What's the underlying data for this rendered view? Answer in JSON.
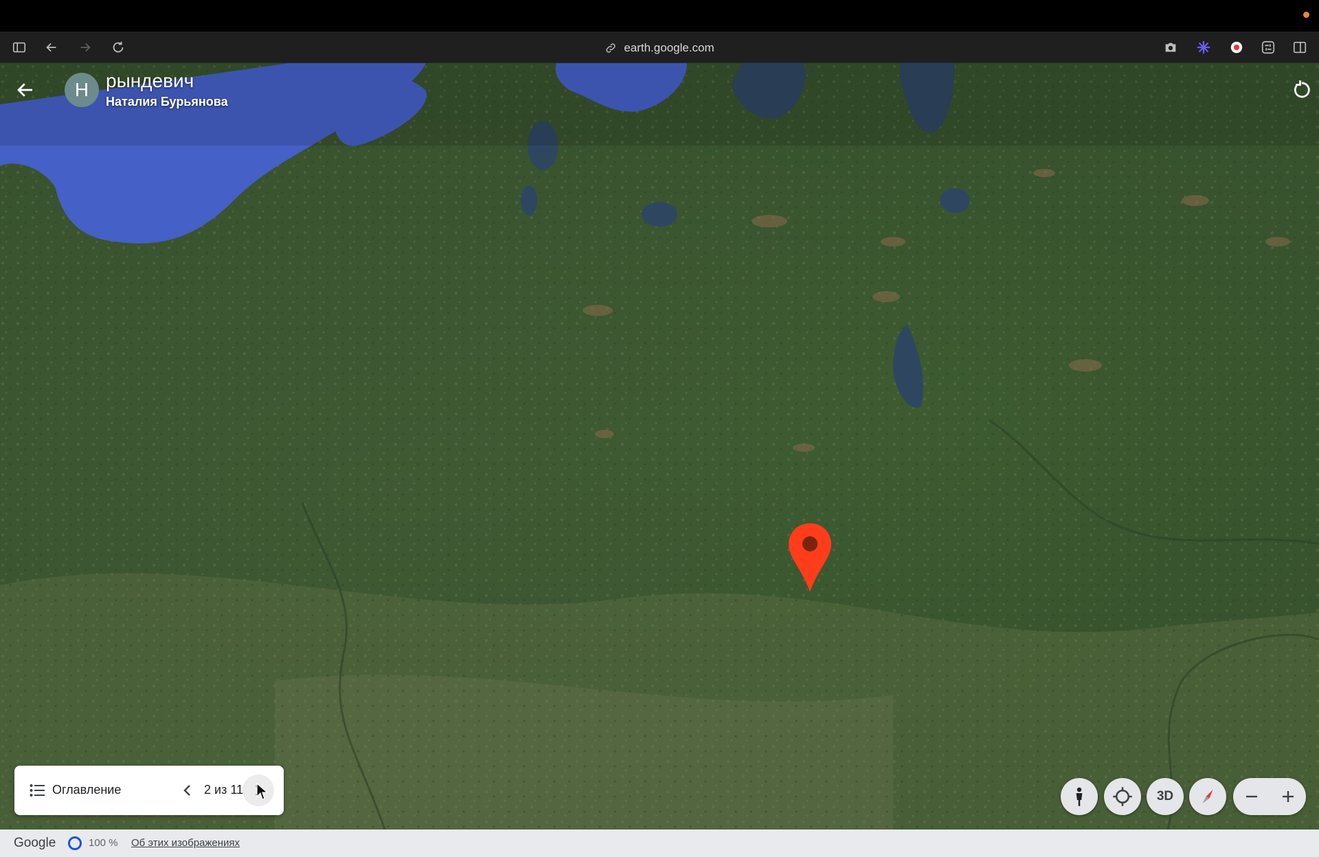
{
  "browser": {
    "url": "earth.google.com"
  },
  "tour": {
    "avatar_letter": "Н",
    "title": "рындевич",
    "author": "Наталия Бурьянова"
  },
  "navigator": {
    "toc_label": "Оглавление",
    "counter": "2 из 11"
  },
  "map_controls": {
    "three_d_label": "3D"
  },
  "statusbar": {
    "brand": "Google",
    "load_percent": "100 %",
    "about_link": "Об этих изображениях"
  },
  "colors": {
    "pin": "#ff3d1a",
    "water": "#4560c6",
    "land": "#3f5a32"
  }
}
